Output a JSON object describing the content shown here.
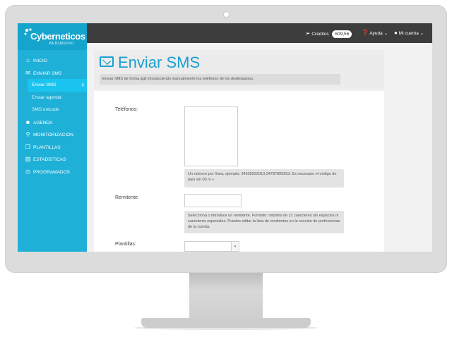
{
  "brand": {
    "name": "Cyberneticos",
    "sub": "WEBSMSPRO"
  },
  "sidebar": {
    "items": [
      {
        "icon": "home-icon",
        "label": "INICIO"
      },
      {
        "icon": "envelope-icon",
        "label": "ENVIAR SMS"
      },
      {
        "label": "Enviar SMS"
      },
      {
        "label": "Enviar agenda"
      },
      {
        "label": "SMS unicode"
      },
      {
        "icon": "users-icon",
        "label": "AGENDA"
      },
      {
        "icon": "search-icon",
        "label": "MONITORIZACION"
      },
      {
        "icon": "copy-icon",
        "label": "PLANTILLAS"
      },
      {
        "icon": "bar-chart-icon",
        "label": "ESTADÍSTICAS"
      },
      {
        "icon": "clock-icon",
        "label": "PROGRAMADOS"
      }
    ]
  },
  "topbar": {
    "credits_label": "Créditos",
    "credits_value": "609,56",
    "help_label": "Ayuda",
    "account_label": "Mi cuenta"
  },
  "page": {
    "title": "Enviar SMS",
    "description": "Enviar SMS de forma ágil introduciendo manualmente los teléfonos de los destinatarios."
  },
  "form": {
    "phones_label": "Teléfonos:",
    "phones_value": "",
    "phones_help": "Un número por línea, ejemplo: 34655922010,34787899353. Es necesario el código de país sin 00 ni +.",
    "sender_label": "Remitente:",
    "sender_value": "",
    "sender_help": "Selecciona o introduce un remitente. Formato: máximo de 11 caracteres sin espacios ni caracteres especiales. Puedes editar la lista de remitentes en la sección de preferencias de la cuenta.",
    "templates_label": "Plantillas:",
    "templates_value": ""
  },
  "colors": {
    "accent": "#1fb0d8",
    "topbar": "#3d3d3d",
    "title": "#1a9fd1"
  }
}
